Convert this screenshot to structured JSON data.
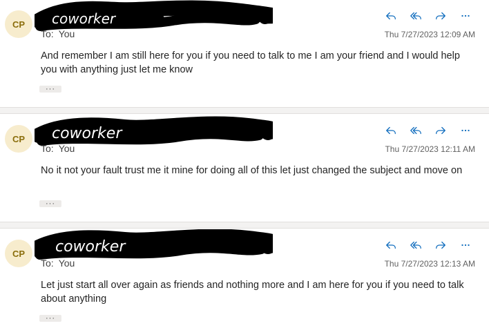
{
  "messages": [
    {
      "avatar_initials": "CP",
      "sender_name": "coworker",
      "to_label": "To:",
      "to_value": "You",
      "timestamp": "Thu 7/27/2023 12:09 AM",
      "body": "And remember I am still here for you if you need to talk to me I am your friend and I would help you with anything just let me know",
      "more_label": "···"
    },
    {
      "avatar_initials": "CP",
      "sender_name": "coworker",
      "to_label": "To:",
      "to_value": "You",
      "timestamp": "Thu 7/27/2023 12:11 AM",
      "body": "No it not your fault trust me it mine for doing all of this let just changed the subject and move on",
      "more_label": "···"
    },
    {
      "avatar_initials": "CP",
      "sender_name": "coworker",
      "to_label": "To:",
      "to_value": "You",
      "timestamp": "Thu 7/27/2023 12:13 AM",
      "body": "Let just start all over again as friends and nothing more and I am here for you if you need to talk about anything",
      "more_label": "···"
    }
  ],
  "actions": [
    "reply-icon",
    "reply-all-icon",
    "forward-icon",
    "more-icon"
  ],
  "colors": {
    "accent": "#0f6cbd",
    "avatar_bg": "#f7eccd",
    "avatar_text": "#8a6d0b",
    "scribble": "#000000"
  }
}
